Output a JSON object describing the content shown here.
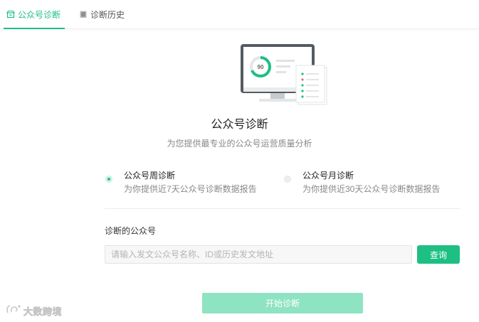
{
  "tabs": [
    {
      "label": "公众号诊断",
      "icon": "shop-icon",
      "active": true
    },
    {
      "label": "诊断历史",
      "icon": "history-icon",
      "active": false
    }
  ],
  "illustration": {
    "score": "90",
    "icon": "monitor-report-icon"
  },
  "header": {
    "title": "公众号诊断",
    "subtitle": "为您提供最专业的公众号运营质量分析"
  },
  "options": [
    {
      "title": "公众号周诊断",
      "desc": "为你提供近7天公众号诊断数据报告",
      "selected": true
    },
    {
      "title": "公众号月诊断",
      "desc": "为你提供近30天公众号诊断数据报告",
      "selected": false
    }
  ],
  "form": {
    "label": "诊断的公众号",
    "placeholder": "请输入发文公众号名称、ID或历史发文地址",
    "value": "",
    "query_label": "查询"
  },
  "start_label": "开始诊断",
  "watermark": {
    "text": "大数跨境",
    "icon": "logo-mark-icon"
  },
  "colors": {
    "accent": "#1dbf83",
    "accent_light": "#8ee3c2"
  }
}
